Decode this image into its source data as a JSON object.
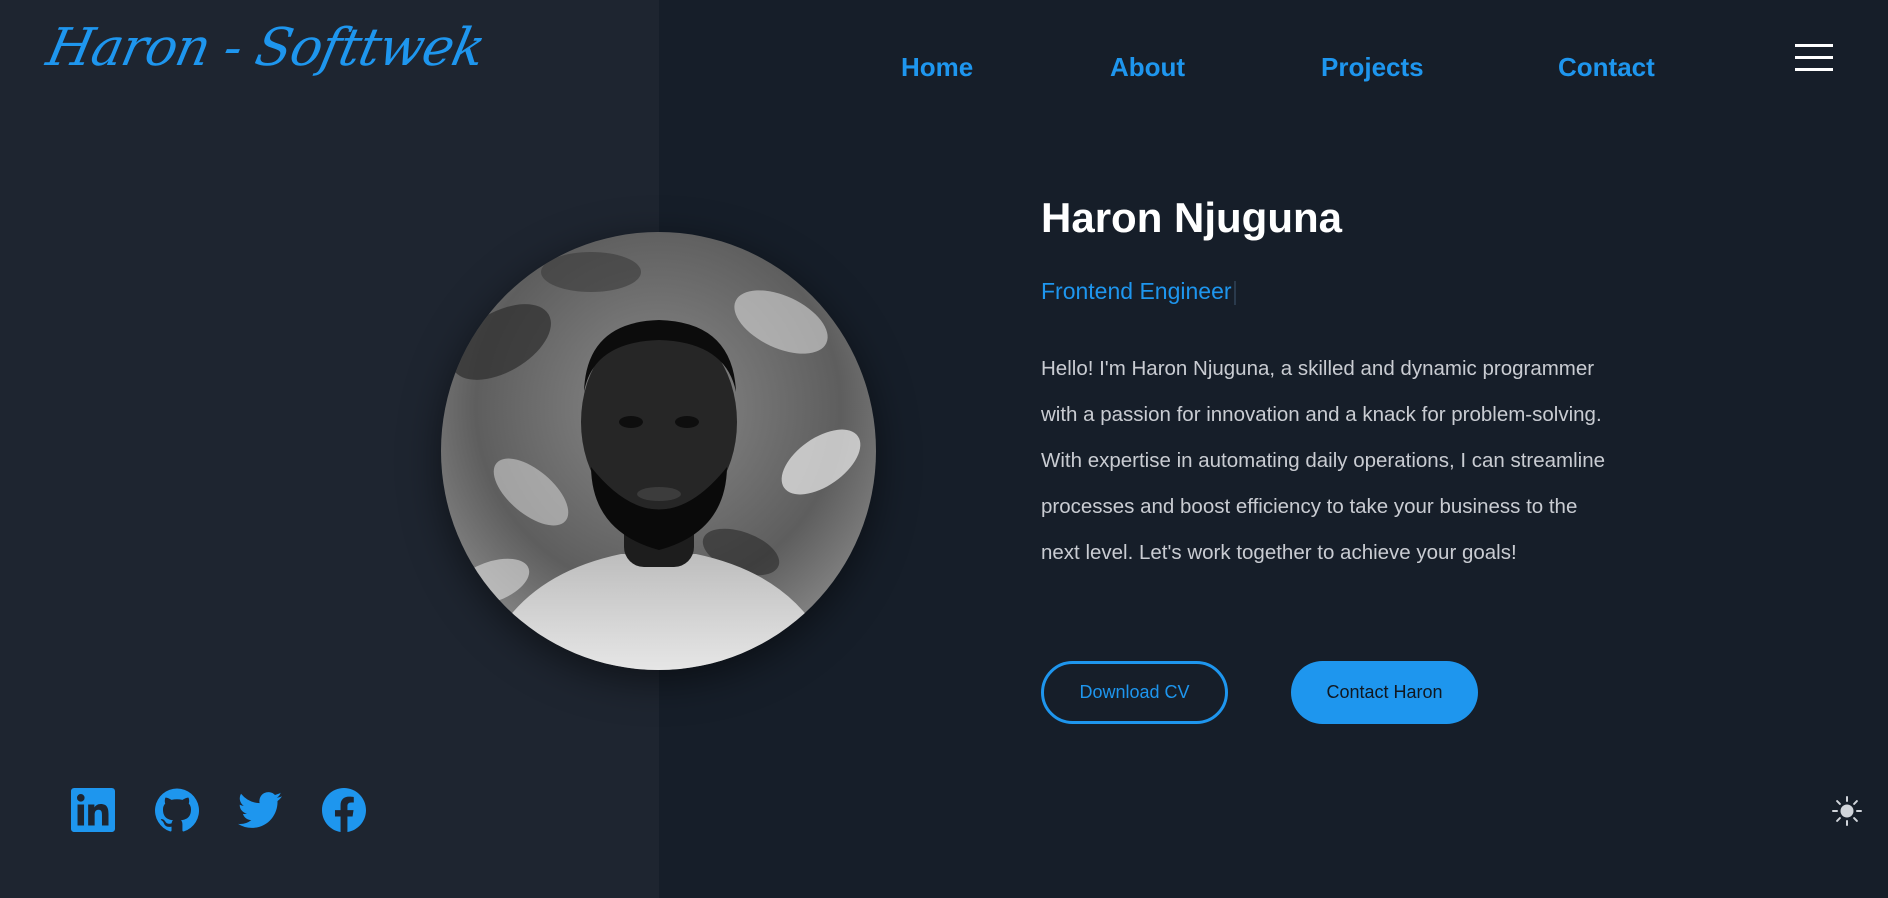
{
  "header": {
    "logo_text": "Haron - Softtwek",
    "nav": [
      {
        "label": "Home"
      },
      {
        "label": "About"
      },
      {
        "label": "Projects"
      },
      {
        "label": "Contact"
      }
    ],
    "menu_icon": "hamburger-menu-icon"
  },
  "hero": {
    "name": "Haron Njuguna",
    "role": "Frontend Engineer",
    "bio": "Hello! I'm Haron Njuguna, a skilled and dynamic programmer with a passion for innovation and a knack for problem-solving. With expertise in automating daily operations, I can streamline processes and boost efficiency to take your business to the next level. Let's work together to achieve your goals!",
    "buttons": {
      "download_cv": "Download CV",
      "contact": "Contact Haron"
    },
    "photo_icon": "profile-photo"
  },
  "social": [
    {
      "icon": "linkedin-icon"
    },
    {
      "icon": "github-icon"
    },
    {
      "icon": "twitter-icon"
    },
    {
      "icon": "facebook-icon"
    }
  ],
  "theme_toggle_icon": "sun-icon",
  "colors": {
    "accent": "#1e96ee",
    "background": "#161e29",
    "panel": "#1e2530",
    "text": "#ffffff",
    "body_text": "#c9ccd2"
  }
}
